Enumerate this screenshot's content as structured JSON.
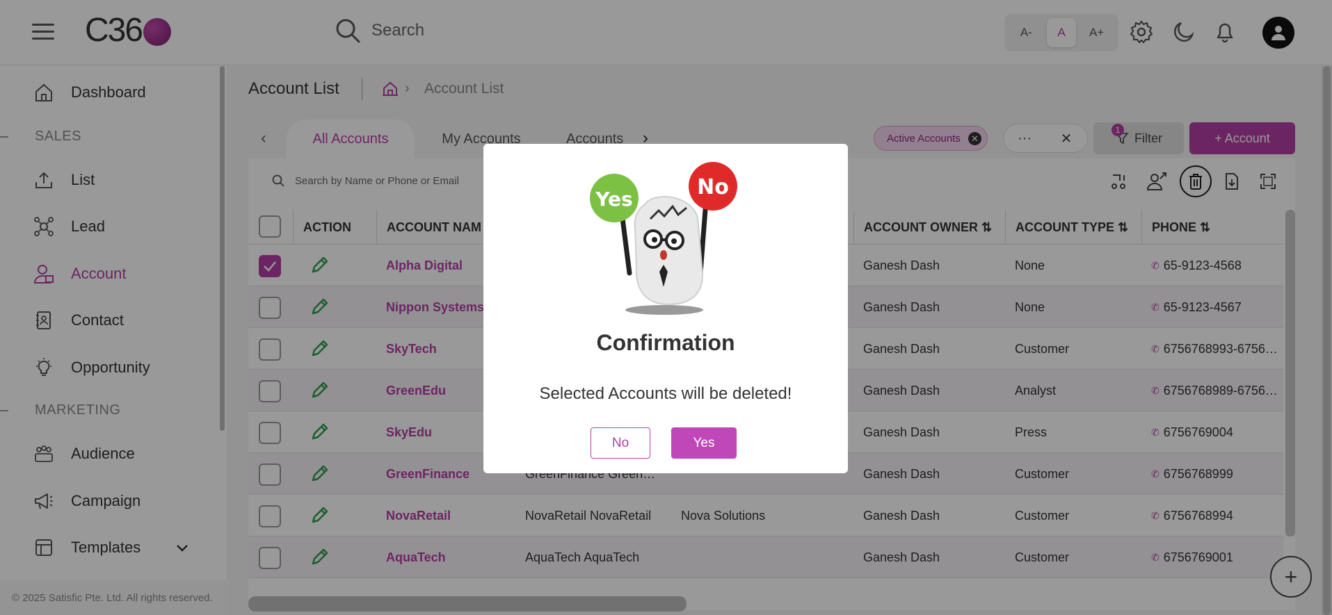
{
  "app": {
    "logo_text": "C36"
  },
  "topbar": {
    "search_label": "Search",
    "font_small": "A-",
    "font_normal": "A",
    "font_large": "A+"
  },
  "sidebar": {
    "items": [
      {
        "label": "Dashboard"
      },
      {
        "label": "List"
      },
      {
        "label": "Lead"
      },
      {
        "label": "Account"
      },
      {
        "label": "Contact"
      },
      {
        "label": "Opportunity"
      },
      {
        "label": "Audience"
      },
      {
        "label": "Campaign"
      },
      {
        "label": "Templates"
      }
    ],
    "sections": {
      "sales": "SALES",
      "marketing": "MARKETING"
    },
    "footer": "© 2025 Satisfic Pte. Ltd. All rights reserved."
  },
  "page": {
    "title": "Account List",
    "breadcrumb_current": "Account List"
  },
  "tabs": [
    {
      "label": "All Accounts"
    },
    {
      "label": "My Accounts"
    },
    {
      "label": "Accounts"
    }
  ],
  "toolbar": {
    "active_chip": "Active Accounts",
    "more": "···",
    "clear": "✕",
    "filter_label": "Filter",
    "filter_count": "1",
    "add_label": "+ Account",
    "search_placeholder": "Search by Name or Phone or Email"
  },
  "table": {
    "headers": {
      "action": "ACTION",
      "account_name": "ACCOUNT NAM",
      "owner": "ACCOUNT OWNER ⇅",
      "type": "ACCOUNT TYPE ⇅",
      "phone": "PHONE ⇅"
    },
    "rows": [
      {
        "name": "Alpha Digital",
        "desc": "",
        "company": "",
        "owner": "Ganesh Dash",
        "type": "None",
        "phone": "65-9123-4568",
        "checked": true
      },
      {
        "name": "Nippon Systems",
        "desc": "",
        "company": "",
        "owner": "Ganesh Dash",
        "type": "None",
        "phone": "65-9123-4567",
        "checked": false
      },
      {
        "name": "SkyTech",
        "desc": "",
        "company": "",
        "owner": "Ganesh Dash",
        "type": "Customer",
        "phone": "6756768993-6756…",
        "checked": false
      },
      {
        "name": "GreenEdu",
        "desc": "",
        "company": "",
        "owner": "Ganesh Dash",
        "type": "Analyst",
        "phone": "6756768989-6756…",
        "checked": false
      },
      {
        "name": "SkyEdu",
        "desc": "",
        "company": "",
        "owner": "Ganesh Dash",
        "type": "Press",
        "phone": "6756769004",
        "checked": false
      },
      {
        "name": "GreenFinance",
        "desc": "GreenFinance Green…",
        "company": "",
        "owner": "Ganesh Dash",
        "type": "Customer",
        "phone": "6756768999",
        "checked": false
      },
      {
        "name": "NovaRetail",
        "desc": "NovaRetail NovaRetail",
        "company": "Nova Solutions",
        "owner": "Ganesh Dash",
        "type": "Customer",
        "phone": "6756768994",
        "checked": false
      },
      {
        "name": "AquaTech",
        "desc": "AquaTech AquaTech",
        "company": "",
        "owner": "Ganesh Dash",
        "type": "Customer",
        "phone": "6756769001",
        "checked": false
      }
    ]
  },
  "modal": {
    "title": "Confirmation",
    "message": "Selected Accounts will be deleted!",
    "no_label": "No",
    "yes_label": "Yes",
    "sign_yes": "Yes",
    "sign_no": "No"
  },
  "colors": {
    "accent": "#b43fa6",
    "edit_icon": "#2e9e4a"
  }
}
